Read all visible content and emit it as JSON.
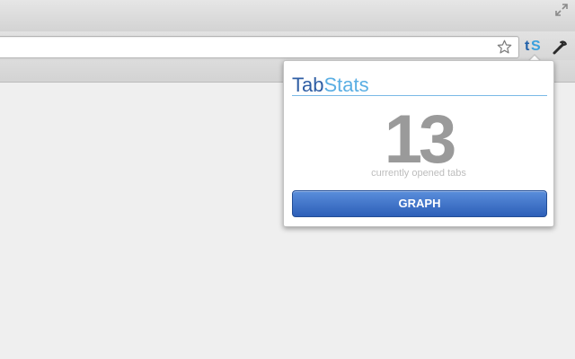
{
  "colors": {
    "title_part1": "#2f5ea4",
    "title_part2": "#5aaee3",
    "count": "#9a9a9a",
    "count_label": "#bdbdbd",
    "button_top": "#5a8edb",
    "button_bottom": "#2d5fb8"
  },
  "toolbar": {
    "star_icon": "star-icon",
    "extension_icon": {
      "t": "t",
      "s": "S"
    },
    "wrench_icon": "wrench-icon"
  },
  "titlebar": {
    "restore_icon": "restore-icon"
  },
  "popup": {
    "title_part1": "Tab",
    "title_part2": "Stats",
    "count": "13",
    "count_label": "currently opened tabs",
    "button_label": "GRAPH"
  }
}
